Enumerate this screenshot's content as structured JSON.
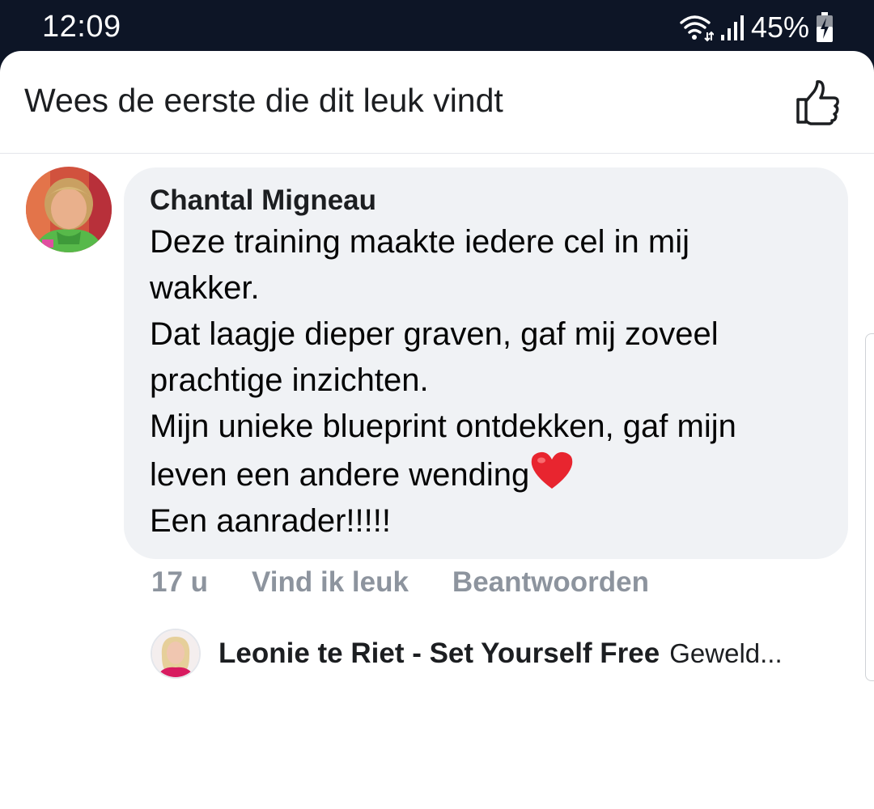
{
  "status_bar": {
    "time": "12:09",
    "battery_percent": "45%",
    "icons": [
      "wifi-icon",
      "signal-icon",
      "battery-charging-icon"
    ]
  },
  "header": {
    "title": "Wees de eerste die dit leuk vindt",
    "like_icon": "thumbs-up-icon"
  },
  "comment": {
    "author": "Chantal Migneau",
    "lines": [
      "Deze training maakte iedere cel in mij",
      "wakker.",
      "Dat laagje dieper graven, gaf mij zoveel",
      "prachtige inzichten.",
      "Mijn unieke blueprint ontdekken, gaf mijn",
      "leven een andere wending",
      "Een aanrader!!!!!"
    ],
    "emoji": "red-heart-icon",
    "time": "17 u",
    "like_label": "Vind ik leuk",
    "reply_label": "Beantwoorden"
  },
  "reply": {
    "author": "Leonie te Riet - Set Yourself Free",
    "preview": "Geweld..."
  },
  "colors": {
    "status_bg": "#0d1526",
    "bubble_bg": "#f0f2f5",
    "muted_text": "#8d949e",
    "heart": "#e8252f"
  }
}
